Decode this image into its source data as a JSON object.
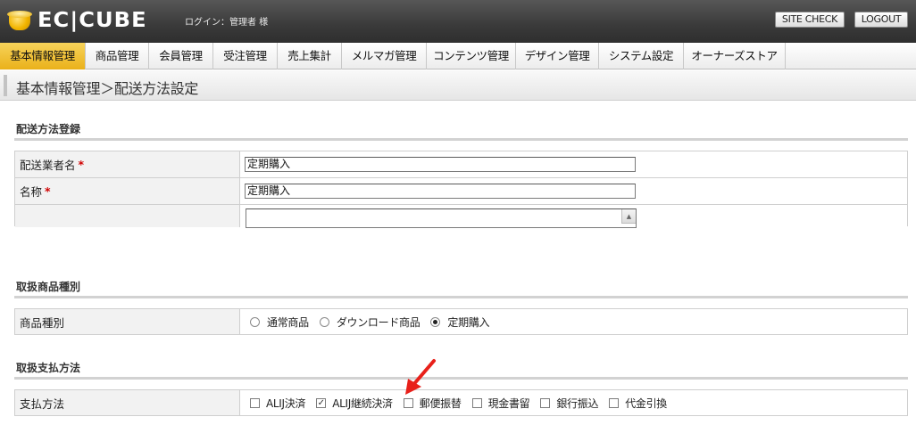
{
  "header": {
    "logo_text": "EC|CUBE",
    "login_text": "ログイン：管理者 様",
    "site_check_label": "SITE CHECK",
    "logout_label": "LOGOUT"
  },
  "nav": {
    "items": [
      {
        "label": "基本情報管理",
        "active": true
      },
      {
        "label": "商品管理"
      },
      {
        "label": "会員管理"
      },
      {
        "label": "受注管理"
      },
      {
        "label": "売上集計"
      },
      {
        "label": "メルマガ管理"
      },
      {
        "label": "コンテンツ管理"
      },
      {
        "label": "デザイン管理"
      },
      {
        "label": "システム設定"
      },
      {
        "label": "オーナーズストア"
      }
    ]
  },
  "breadcrumb": "基本情報管理＞配送方法設定",
  "sections": {
    "delivery": {
      "title": "配送方法登録",
      "carrier_label": "配送業者名",
      "carrier_value": "定期購入",
      "name_label": "名称",
      "name_value": "定期購入",
      "required_mark": "*"
    },
    "product_type": {
      "title": "取扱商品種別",
      "label": "商品種別",
      "options": [
        {
          "label": "通常商品",
          "checked": false
        },
        {
          "label": "ダウンロード商品",
          "checked": false
        },
        {
          "label": "定期購入",
          "checked": true
        }
      ]
    },
    "payment": {
      "title": "取扱支払方法",
      "label": "支払方法",
      "options": [
        {
          "label": "ALIJ決済",
          "checked": false
        },
        {
          "label": "ALIJ継続決済",
          "checked": true
        },
        {
          "label": "郵便振替",
          "checked": false
        },
        {
          "label": "現金書留",
          "checked": false
        },
        {
          "label": "銀行振込",
          "checked": false
        },
        {
          "label": "代金引換",
          "checked": false
        }
      ]
    }
  },
  "colors": {
    "header_bg": "#3a3a3a",
    "nav_active": "#eab11a",
    "required": "#d00000",
    "annotation_arrow": "#e8201a"
  }
}
